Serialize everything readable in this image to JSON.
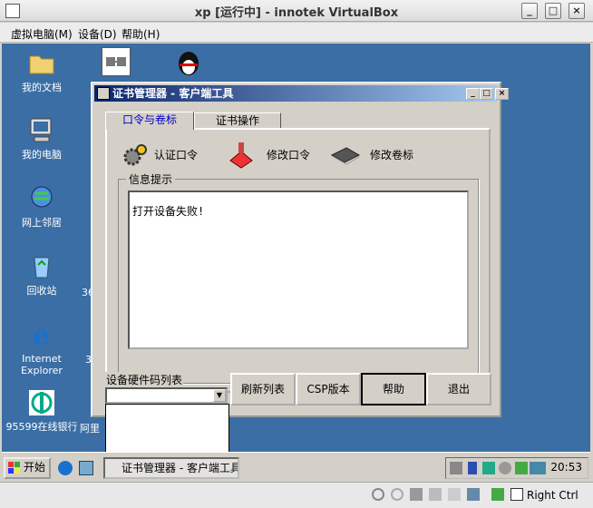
{
  "vbox": {
    "title": "xp [运行中] - innotek VirtualBox",
    "menu": [
      "虚拟电脑(M)",
      "设备(D)",
      "帮助(H)"
    ],
    "host_key": "Right Ctrl"
  },
  "desktop": {
    "icons": [
      {
        "label": "我的文档"
      },
      {
        "label": "我的电脑"
      },
      {
        "label": "网上邻居"
      },
      {
        "label": "回收站"
      },
      {
        "label": "Internet Explorer"
      },
      {
        "label": "95599在线银行"
      }
    ],
    "partial_labels": [
      "36",
      "3",
      "阿里"
    ]
  },
  "taskbar": {
    "start_label": "开始",
    "task_label": "证书管理器 - 客户端工具",
    "clock": "20:53"
  },
  "dialog": {
    "title": "证书管理器 - 客户端工具",
    "tabs": [
      "口令与卷标",
      "证书操作"
    ],
    "tools": {
      "auth": "认证口令",
      "change_pin": "修改口令",
      "change_label": "修改卷标"
    },
    "info_group": "信息提示",
    "message": "打开设备失败!",
    "device_list_label": "设备硬件码列表",
    "buttons": {
      "refresh": "刷新列表",
      "csp": "CSP版本",
      "help": "帮助",
      "exit": "退出"
    }
  },
  "colors": {
    "desktop": "#3a6ea5",
    "title_active": "#0a246a",
    "tab_active_text": "#0000cc"
  }
}
